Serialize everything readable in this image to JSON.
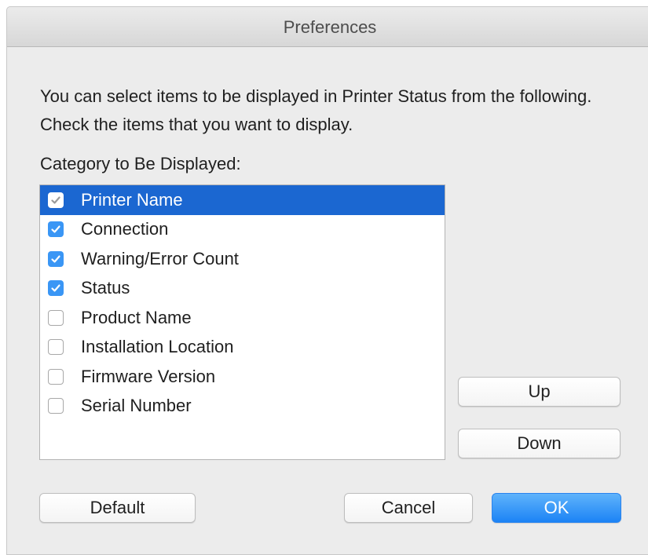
{
  "window": {
    "title": "Preferences"
  },
  "intro": {
    "text": "You can select items to be displayed in Printer Status from the following. Check the items that you want to display."
  },
  "category": {
    "label": "Category to Be Displayed:"
  },
  "list": {
    "items": [
      {
        "label": "Printer Name",
        "checked": true,
        "selected": true
      },
      {
        "label": "Connection",
        "checked": true,
        "selected": false
      },
      {
        "label": "Warning/Error Count",
        "checked": true,
        "selected": false
      },
      {
        "label": "Status",
        "checked": true,
        "selected": false
      },
      {
        "label": "Product Name",
        "checked": false,
        "selected": false
      },
      {
        "label": "Installation Location",
        "checked": false,
        "selected": false
      },
      {
        "label": "Firmware Version",
        "checked": false,
        "selected": false
      },
      {
        "label": "Serial Number",
        "checked": false,
        "selected": false
      }
    ]
  },
  "buttons": {
    "up": "Up",
    "down": "Down",
    "default": "Default",
    "cancel": "Cancel",
    "ok": "OK"
  },
  "colors": {
    "selection": "#1b67d1",
    "accent": "#3a96f5",
    "primary_button": "#1c83f5"
  },
  "icons": {
    "checkbox_checked": "checkmark-icon",
    "checkbox_unchecked": "empty-checkbox-icon"
  }
}
